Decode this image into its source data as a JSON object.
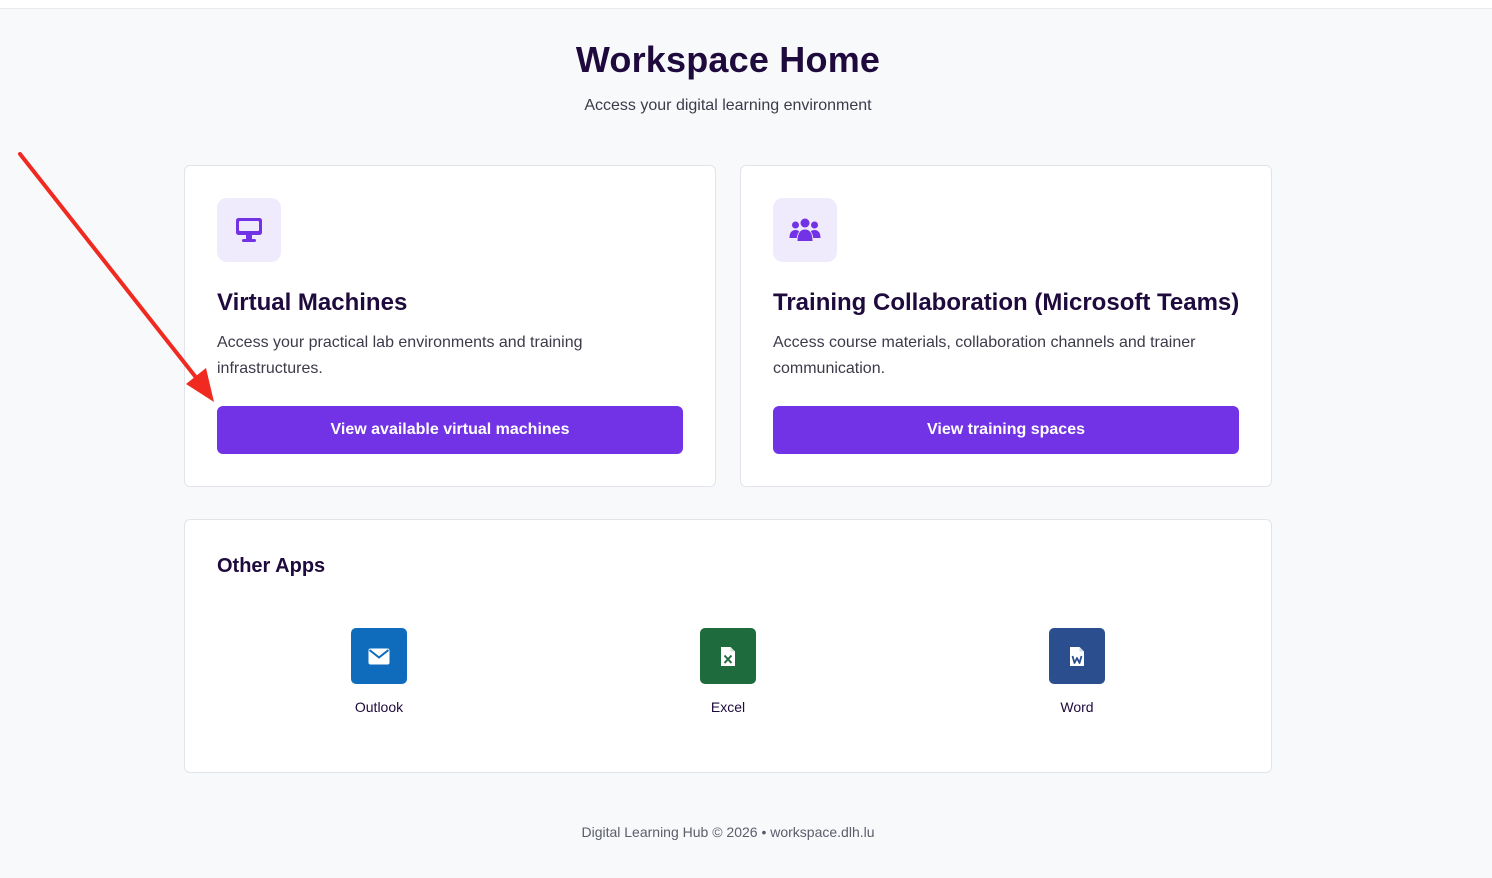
{
  "header": {
    "title": "Workspace Home",
    "subtitle": "Access your digital learning environment"
  },
  "cards": {
    "virtual_machines": {
      "icon": "monitor-icon",
      "title": "Virtual Machines",
      "description": "Access your practical lab environments and training infrastructures.",
      "button_label": "View available virtual machines"
    },
    "teams": {
      "icon": "users-group-icon",
      "title": "Training Collaboration (Microsoft Teams)",
      "description": "Access course materials, collaboration channels and trainer communication.",
      "button_label": "View training spaces"
    }
  },
  "other_apps": {
    "title": "Other Apps",
    "apps": [
      {
        "label": "Outlook",
        "icon": "envelope-icon",
        "color": "#0f6cbd"
      },
      {
        "label": "Excel",
        "icon": "excel-file-icon",
        "color": "#1e6b3d"
      },
      {
        "label": "Word",
        "icon": "word-file-icon",
        "color": "#2b4f8e"
      }
    ]
  },
  "footer": {
    "text": "Digital Learning Hub © 2026 • workspace.dlh.lu"
  },
  "colors": {
    "accent": "#7232e6",
    "title": "#1e0a3c",
    "icon_bg": "#f0eafd",
    "annotation_arrow": "#f02a21"
  }
}
